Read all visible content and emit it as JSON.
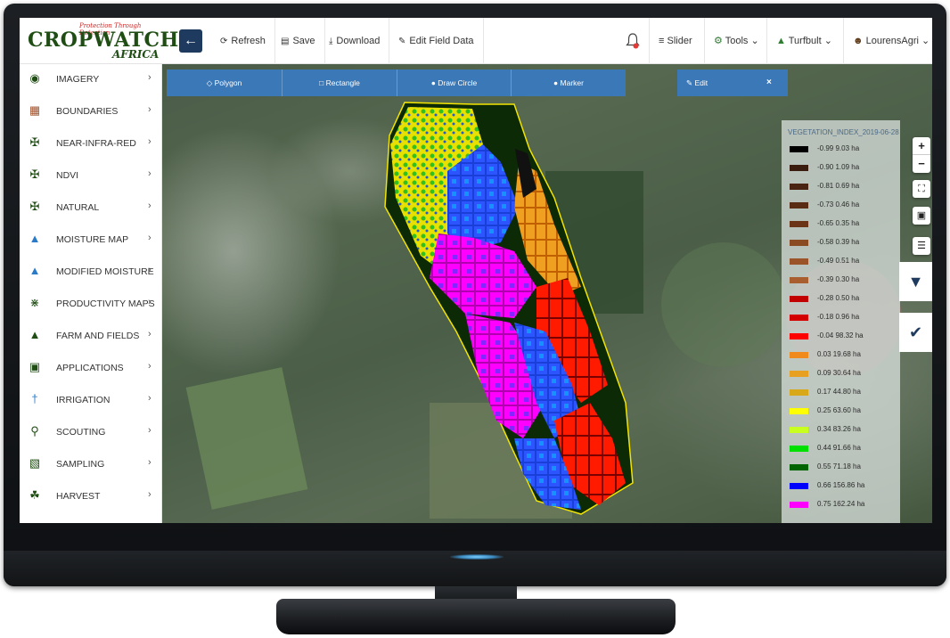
{
  "brand": {
    "tagline": "Protection Through Detection",
    "name": "CROPWATCH",
    "sub": "AFRICA"
  },
  "toolbar": {
    "back_icon": "arrow-left-icon",
    "refresh": "Refresh",
    "save": "Save",
    "download": "Download",
    "edit_field_data": "Edit Field Data",
    "slider": "Slider",
    "tools": "Tools",
    "farm": "Turfbult",
    "user": "LourensAgri"
  },
  "sidebar": {
    "items": [
      {
        "label": "IMAGERY",
        "icon": "satellite-icon"
      },
      {
        "label": "BOUNDARIES",
        "icon": "field-boundary-icon"
      },
      {
        "label": "NEAR-INFRA-RED",
        "icon": "drone-icon"
      },
      {
        "label": "NDVI",
        "icon": "drone-icon"
      },
      {
        "label": "NATURAL",
        "icon": "drone-icon"
      },
      {
        "label": "MOISTURE MAP",
        "icon": "water-drop-icon"
      },
      {
        "label": "MODIFIED MOISTURE",
        "icon": "water-drop-icon"
      },
      {
        "label": "PRODUCTIVITY MAPS",
        "icon": "plants-icon"
      },
      {
        "label": "FARM AND FIELDS",
        "icon": "farm-icon"
      },
      {
        "label": "APPLICATIONS",
        "icon": "sprayer-icon"
      },
      {
        "label": "IRRIGATION",
        "icon": "sprinkler-icon"
      },
      {
        "label": "SCOUTING",
        "icon": "magnifier-icon"
      },
      {
        "label": "SAMPLING",
        "icon": "sample-icon"
      },
      {
        "label": "HARVEST",
        "icon": "harvest-icon"
      }
    ]
  },
  "draw_tools": {
    "polygon": "Polygon",
    "rectangle": "Rectangle",
    "circle": "Draw Circle",
    "marker": "Marker",
    "edit": "Edit",
    "close": "×"
  },
  "legend": {
    "title": "VEGETATION_INDEX_2019-06-28",
    "rows": [
      {
        "text": "-0.99 9.03 ha",
        "color": "#000000"
      },
      {
        "text": "-0.90 1.09 ha",
        "color": "#3b1d10"
      },
      {
        "text": "-0.81 0.69 ha",
        "color": "#4a2412"
      },
      {
        "text": "-0.73 0.46 ha",
        "color": "#5a2c14"
      },
      {
        "text": "-0.65 0.35 ha",
        "color": "#6b3417"
      },
      {
        "text": "-0.58 0.39 ha",
        "color": "#8a4a22"
      },
      {
        "text": "-0.49 0.51 ha",
        "color": "#9a5428"
      },
      {
        "text": "-0.39 0.30 ha",
        "color": "#a85e2e"
      },
      {
        "text": "-0.28 0.50 ha",
        "color": "#c20000"
      },
      {
        "text": "-0.18 0.96 ha",
        "color": "#d40000"
      },
      {
        "text": "-0.04 98.32 ha",
        "color": "#ff0000"
      },
      {
        "text": "0.03 19.68 ha",
        "color": "#f08a1c"
      },
      {
        "text": "0.09 30.64 ha",
        "color": "#e8a020"
      },
      {
        "text": "0.17 44.80 ha",
        "color": "#d8a818"
      },
      {
        "text": "0.25 63.60 ha",
        "color": "#ffff00"
      },
      {
        "text": "0.34 83.26 ha",
        "color": "#c8ff1e"
      },
      {
        "text": "0.44 91.66 ha",
        "color": "#00e000"
      },
      {
        "text": "0.55 71.18 ha",
        "color": "#006400"
      },
      {
        "text": "0.66 156.86 ha",
        "color": "#0000ff"
      },
      {
        "text": "0.75 162.24 ha",
        "color": "#ff00ff"
      }
    ]
  },
  "map_controls": {
    "zoom_in": "+",
    "zoom_out": "−"
  }
}
